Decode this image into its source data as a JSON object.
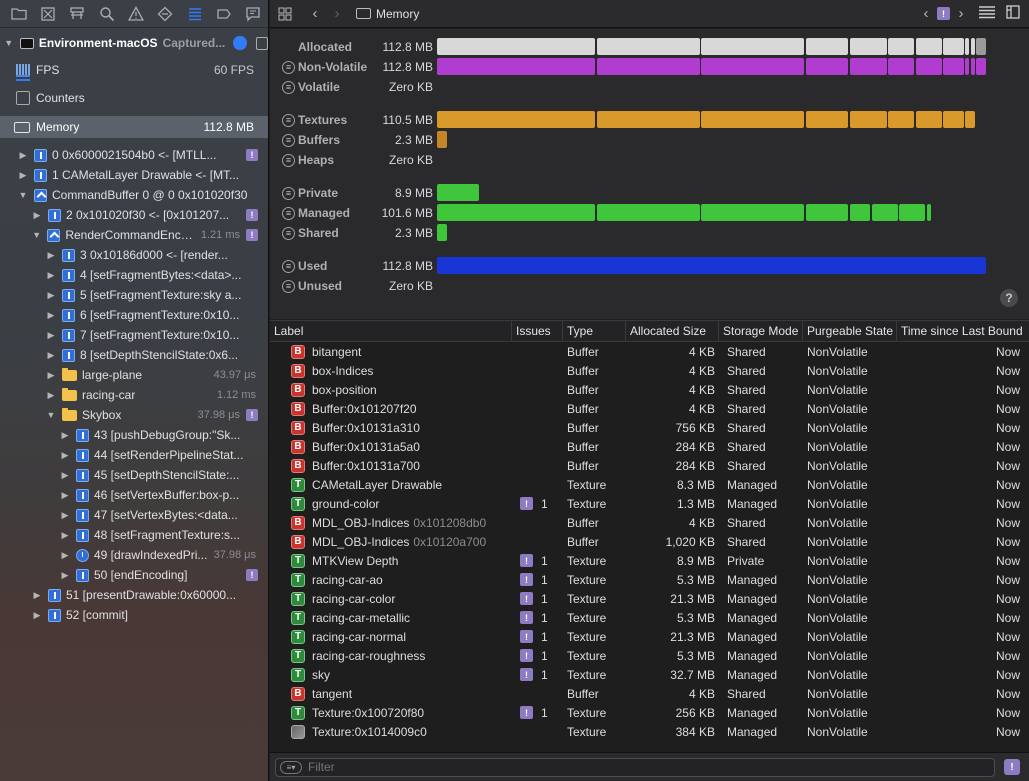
{
  "toolbar_icons": [
    "folder-icon",
    "grid-x-icon",
    "hierarchy-icon",
    "search-icon",
    "warning-icon",
    "diamond-icon",
    "list-icon",
    "tag-icon",
    "comment-icon"
  ],
  "sidebar": {
    "capture_title": "Environment-macOS",
    "capture_subtitle": "Captured...",
    "fps_label": "FPS",
    "fps_value": "60 FPS",
    "counters_label": "Counters",
    "memory_label": "Memory",
    "memory_value": "112.8 MB",
    "tree": [
      {
        "label": "0 0x6000021504b0 <- [MTLL...",
        "indent": 0,
        "icon": "cmd",
        "tri": "▶",
        "warn": true
      },
      {
        "label": "1 CAMetalLayer Drawable <- [MT...",
        "indent": 0,
        "icon": "cmd",
        "tri": "▶"
      },
      {
        "label": "CommandBuffer 0 @ 0 0x101020f30",
        "indent": 0,
        "icon": "cmdbuf",
        "tri": "▼"
      },
      {
        "label": "2 0x101020f30 <- [0x101207...",
        "indent": 1,
        "icon": "cmd",
        "tri": "▶",
        "warn": true
      },
      {
        "label": "RenderCommandEncod...",
        "indent": 1,
        "icon": "chev",
        "tri": "▼",
        "time": "1.21 ms",
        "warn": true
      },
      {
        "label": "3 0x10186d000 <- [render...",
        "indent": 2,
        "icon": "cmd",
        "tri": "▶"
      },
      {
        "label": "4 [setFragmentBytes:<data>...",
        "indent": 2,
        "icon": "cmd",
        "tri": "▶"
      },
      {
        "label": "5 [setFragmentTexture:sky a...",
        "indent": 2,
        "icon": "cmd",
        "tri": "▶"
      },
      {
        "label": "6 [setFragmentTexture:0x10...",
        "indent": 2,
        "icon": "cmd",
        "tri": "▶"
      },
      {
        "label": "7 [setFragmentTexture:0x10...",
        "indent": 2,
        "icon": "cmd",
        "tri": "▶"
      },
      {
        "label": "8 [setDepthStencilState:0x6...",
        "indent": 2,
        "icon": "cmd",
        "tri": "▶"
      },
      {
        "label": "large-plane",
        "indent": 2,
        "icon": "folder",
        "tri": "▶",
        "time": "43.97 μs"
      },
      {
        "label": "racing-car",
        "indent": 2,
        "icon": "folder",
        "tri": "▶",
        "time": "1.12 ms"
      },
      {
        "label": "Skybox",
        "indent": 2,
        "icon": "folder",
        "tri": "▼",
        "time": "37.98 μs",
        "warn": true
      },
      {
        "label": "43 [pushDebugGroup:\"Sk...",
        "indent": 3,
        "icon": "cmd",
        "tri": "▶"
      },
      {
        "label": "44 [setRenderPipelineStat...",
        "indent": 3,
        "icon": "cmd",
        "tri": "▶"
      },
      {
        "label": "45 [setDepthStencilState:...",
        "indent": 3,
        "icon": "cmd",
        "tri": "▶"
      },
      {
        "label": "46 [setVertexBuffer:box-p...",
        "indent": 3,
        "icon": "cmd",
        "tri": "▶"
      },
      {
        "label": "47 [setVertexBytes:<data...",
        "indent": 3,
        "icon": "cmd",
        "tri": "▶"
      },
      {
        "label": "48 [setFragmentTexture:s...",
        "indent": 3,
        "icon": "cmd",
        "tri": "▶"
      },
      {
        "label": "49 [drawIndexedPri...",
        "indent": 3,
        "icon": "clock",
        "tri": "▶",
        "time": "37.98 μs"
      },
      {
        "label": "50 [endEncoding]",
        "indent": 3,
        "icon": "cmd",
        "tri": "▶",
        "warn": true
      },
      {
        "label": "51 [presentDrawable:0x60000...",
        "indent": 1,
        "icon": "cmd",
        "tri": "▶"
      },
      {
        "label": "52 [commit]",
        "indent": 1,
        "icon": "cmd",
        "tri": "▶"
      }
    ]
  },
  "main_toolbar": {
    "title": "Memory",
    "back": "‹",
    "forward": "›",
    "warn_badge": "!"
  },
  "memory_chart": {
    "rows": [
      {
        "name": "Allocated",
        "value": "112.8 MB",
        "color": "#d8d8d8",
        "fraction": 1.0,
        "segments": [
          0.0,
          0.29,
          0.48,
          0.67,
          0.75,
          0.82,
          0.87,
          0.92,
          0.96,
          0.97,
          0.98
        ]
      },
      {
        "name": "Non-Volatile",
        "value": "112.8 MB",
        "color": "#b03dd0",
        "fraction": 1.0,
        "segments": [
          0.0,
          0.29,
          0.48,
          0.67,
          0.75,
          0.82,
          0.87,
          0.92,
          0.96,
          0.97,
          0.98
        ]
      },
      {
        "name": "Volatile",
        "value": "Zero KB",
        "color": "#888888",
        "fraction": 0
      },
      {
        "name": "Textures",
        "value": "110.5 MB",
        "color": "#d99a2b",
        "fraction": 0.98,
        "segments": [
          0.0,
          0.29,
          0.48,
          0.67,
          0.75,
          0.82,
          0.87,
          0.92,
          0.96
        ]
      },
      {
        "name": "Buffers",
        "value": "2.3 MB",
        "color": "#c7852a",
        "fraction": 0.02
      },
      {
        "name": "Heaps",
        "value": "Zero KB",
        "color": "#888888",
        "fraction": 0
      },
      {
        "name": "Private",
        "value": "8.9 MB",
        "color": "#3fc63a",
        "fraction": 0.079
      },
      {
        "name": "Managed",
        "value": "101.6 MB",
        "color": "#3fc63a",
        "fraction": 0.9,
        "segments": [
          0.0,
          0.29,
          0.48,
          0.67,
          0.75,
          0.79,
          0.84,
          0.89
        ]
      },
      {
        "name": "Shared",
        "value": "2.3 MB",
        "color": "#3fc63a",
        "fraction": 0.02
      },
      {
        "name": "Used",
        "value": "112.8 MB",
        "color": "#1836d6",
        "fraction": 1.0
      },
      {
        "name": "Unused",
        "value": "Zero KB",
        "color": "#888888",
        "fraction": 0
      }
    ],
    "help": "?"
  },
  "table": {
    "headers": [
      "Label",
      "Issues",
      "Type",
      "Allocated Size",
      "Storage Mode",
      "Purgeable State",
      "Time since Last Bound"
    ],
    "rows": [
      {
        "kind": "B",
        "label": "bitangent",
        "sub": "",
        "issues": "",
        "type": "Buffer",
        "size": "4 KB",
        "storage": "Shared",
        "purge": "NonVolatile",
        "time": "Now"
      },
      {
        "kind": "B",
        "label": "box-Indices",
        "sub": "",
        "issues": "",
        "type": "Buffer",
        "size": "4 KB",
        "storage": "Shared",
        "purge": "NonVolatile",
        "time": "Now"
      },
      {
        "kind": "B",
        "label": "box-position",
        "sub": "",
        "issues": "",
        "type": "Buffer",
        "size": "4 KB",
        "storage": "Shared",
        "purge": "NonVolatile",
        "time": "Now"
      },
      {
        "kind": "B",
        "label": "Buffer:0x101207f20",
        "sub": "",
        "issues": "",
        "type": "Buffer",
        "size": "4 KB",
        "storage": "Shared",
        "purge": "NonVolatile",
        "time": "Now"
      },
      {
        "kind": "B",
        "label": "Buffer:0x10131a310",
        "sub": "",
        "issues": "",
        "type": "Buffer",
        "size": "756 KB",
        "storage": "Shared",
        "purge": "NonVolatile",
        "time": "Now"
      },
      {
        "kind": "B",
        "label": "Buffer:0x10131a5a0",
        "sub": "",
        "issues": "",
        "type": "Buffer",
        "size": "284 KB",
        "storage": "Shared",
        "purge": "NonVolatile",
        "time": "Now"
      },
      {
        "kind": "B",
        "label": "Buffer:0x10131a700",
        "sub": "",
        "issues": "",
        "type": "Buffer",
        "size": "284 KB",
        "storage": "Shared",
        "purge": "NonVolatile",
        "time": "Now"
      },
      {
        "kind": "T",
        "label": "CAMetalLayer Drawable",
        "sub": "",
        "issues": "",
        "type": "Texture",
        "size": "8.3 MB",
        "storage": "Managed",
        "purge": "NonVolatile",
        "time": "Now"
      },
      {
        "kind": "T",
        "label": "ground-color",
        "sub": "",
        "issues": "1",
        "type": "Texture",
        "size": "1.3 MB",
        "storage": "Managed",
        "purge": "NonVolatile",
        "time": "Now"
      },
      {
        "kind": "B",
        "label": "MDL_OBJ-Indices",
        "sub": "0x101208db0",
        "issues": "",
        "type": "Buffer",
        "size": "4 KB",
        "storage": "Shared",
        "purge": "NonVolatile",
        "time": "Now"
      },
      {
        "kind": "B",
        "label": "MDL_OBJ-Indices",
        "sub": "0x10120a700",
        "issues": "",
        "type": "Buffer",
        "size": "1,020 KB",
        "storage": "Shared",
        "purge": "NonVolatile",
        "time": "Now"
      },
      {
        "kind": "T",
        "label": "MTKView Depth",
        "sub": "",
        "issues": "1",
        "type": "Texture",
        "size": "8.9 MB",
        "storage": "Private",
        "purge": "NonVolatile",
        "time": "Now"
      },
      {
        "kind": "T",
        "label": "racing-car-ao",
        "sub": "",
        "issues": "1",
        "type": "Texture",
        "size": "5.3 MB",
        "storage": "Managed",
        "purge": "NonVolatile",
        "time": "Now"
      },
      {
        "kind": "T",
        "label": "racing-car-color",
        "sub": "",
        "issues": "1",
        "type": "Texture",
        "size": "21.3 MB",
        "storage": "Managed",
        "purge": "NonVolatile",
        "time": "Now"
      },
      {
        "kind": "T",
        "label": "racing-car-metallic",
        "sub": "",
        "issues": "1",
        "type": "Texture",
        "size": "5.3 MB",
        "storage": "Managed",
        "purge": "NonVolatile",
        "time": "Now"
      },
      {
        "kind": "T",
        "label": "racing-car-normal",
        "sub": "",
        "issues": "1",
        "type": "Texture",
        "size": "21.3 MB",
        "storage": "Managed",
        "purge": "NonVolatile",
        "time": "Now"
      },
      {
        "kind": "T",
        "label": "racing-car-roughness",
        "sub": "",
        "issues": "1",
        "type": "Texture",
        "size": "5.3 MB",
        "storage": "Managed",
        "purge": "NonVolatile",
        "time": "Now"
      },
      {
        "kind": "T",
        "label": "sky",
        "sub": "",
        "issues": "1",
        "type": "Texture",
        "size": "32.7 MB",
        "storage": "Managed",
        "purge": "NonVolatile",
        "time": "Now"
      },
      {
        "kind": "B",
        "label": "tangent",
        "sub": "",
        "issues": "",
        "type": "Buffer",
        "size": "4 KB",
        "storage": "Shared",
        "purge": "NonVolatile",
        "time": "Now"
      },
      {
        "kind": "T",
        "label": "Texture:0x100720f80",
        "sub": "",
        "issues": "1",
        "type": "Texture",
        "size": "256 KB",
        "storage": "Managed",
        "purge": "NonVolatile",
        "time": "Now"
      },
      {
        "kind": "img",
        "label": "Texture:0x1014009c0",
        "sub": "",
        "issues": "",
        "type": "Texture",
        "size": "384 KB",
        "storage": "Managed",
        "purge": "NonVolatile",
        "time": "Now"
      }
    ]
  },
  "filter": {
    "placeholder": "Filter"
  }
}
